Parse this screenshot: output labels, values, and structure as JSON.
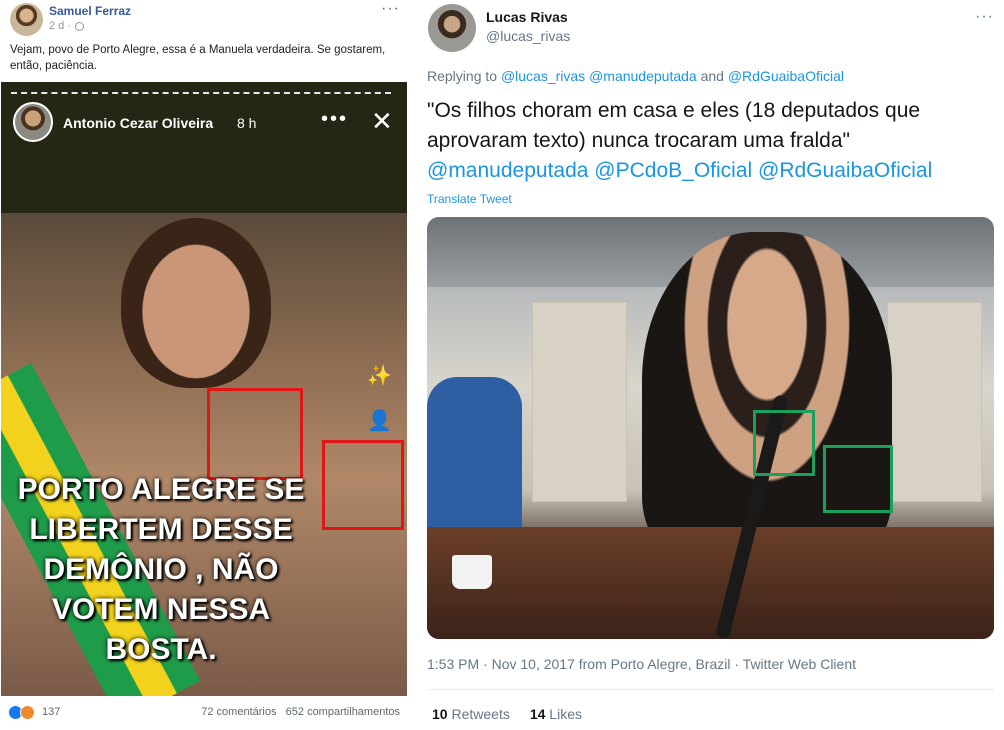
{
  "facebook_post": {
    "author": "Samuel Ferraz",
    "time": "2 d ·",
    "more_icon": "more-horizontal-icon",
    "text": "Vejam, povo de Porto Alegre, essa é a Manuela verdadeira. Se gostarem, então, paciência.",
    "story": {
      "author": "Antonio Cezar Oliveira",
      "time": "8 h",
      "more_icon": "more-horizontal-icon",
      "close_icon": "close-icon",
      "caption": "PORTO ALEGRE SE LIBERTEM DESSE DEMÔNIO , NÃO VOTEM NESSA BOSTA."
    },
    "reactions_count": "137",
    "comments": "72 comentários",
    "shares": "652 compartilhamentos",
    "highlight_color": "#e01515"
  },
  "tweet": {
    "name": "Lucas Rivas",
    "handle": "@lucas_rivas",
    "replying_label": "Replying to",
    "reply_mentions": [
      "@lucas_rivas",
      "@manudeputada",
      "and",
      "@RdGuaibaOficial"
    ],
    "text": "\"Os filhos choram em casa e eles (18 deputados que aprovaram texto) nunca trocaram uma fralda\"",
    "text_mentions": [
      "@manudeputada",
      "@PCdoB_Oficial",
      "@RdGuaibaOficial"
    ],
    "translate": "Translate Tweet",
    "meta": "1:53 PM · Nov 10, 2017 from Porto Alegre, Brazil · Twitter Web Client",
    "retweets_count": "10",
    "retweets_label": "Retweets",
    "likes_count": "14",
    "likes_label": "Likes",
    "highlight_color": "#1aa05a",
    "link_color": "#1b95e0"
  }
}
